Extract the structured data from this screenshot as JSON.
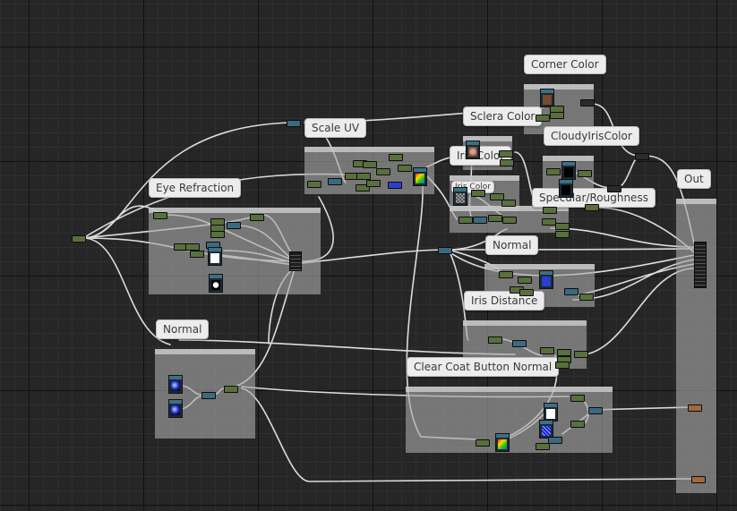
{
  "graph": {
    "comments": {
      "corner_color": "Corner Color",
      "scale_uv": "Scale UV",
      "sclera_color": "Sclera Color",
      "cloudy_iris_color": "CloudyIrisColor",
      "iris_color": "Iris Color",
      "iris_color_sub": "Iris Color",
      "eye_refraction": "Eye Refraction",
      "specular_roughness": "Specular/Roughness",
      "out": "Out",
      "normal_left": "Normal",
      "normal_right": "Normal",
      "iris_distance": "Iris Distance",
      "clear_coat_button_normal": "Clear Coat Button Normal"
    },
    "wire_color": "#d9d9d9"
  }
}
